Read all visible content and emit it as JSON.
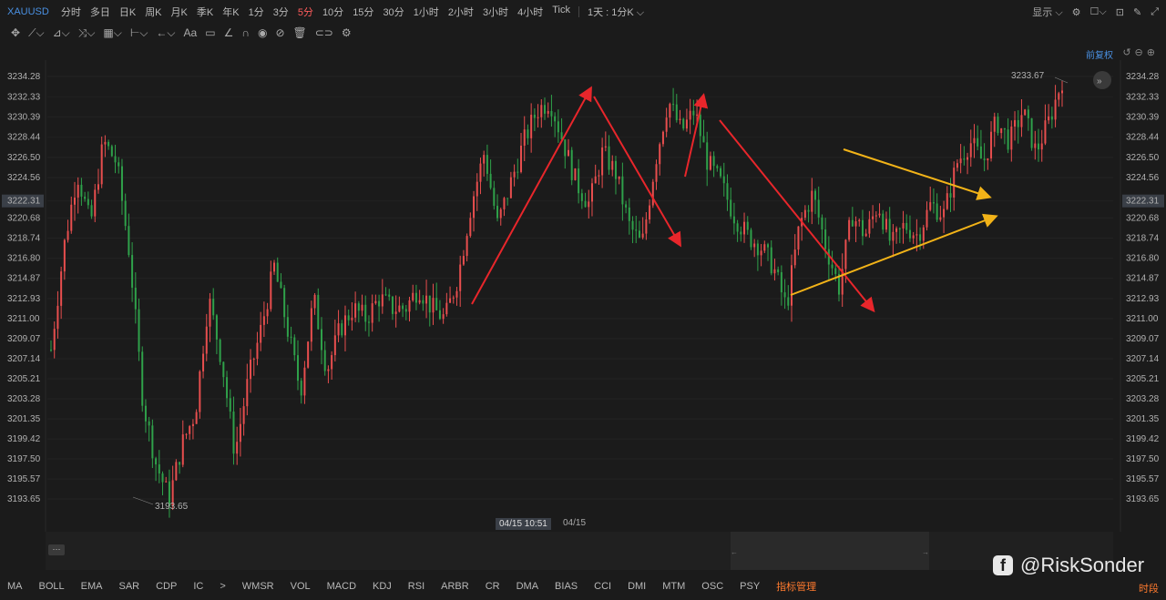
{
  "symbol": "XAUUSD",
  "timeframes": [
    "分时",
    "多日",
    "日K",
    "周K",
    "月K",
    "季K",
    "年K",
    "1分",
    "3分",
    "5分",
    "10分",
    "15分",
    "30分",
    "1小时",
    "2小时",
    "3小时",
    "4小时",
    "Tick"
  ],
  "active_timeframe": "5分",
  "period_select": "1天 : 1分K ⌵",
  "top_right": {
    "display_label": "显示 ⌵"
  },
  "price_adjust": "前复权",
  "y_ticks": [
    "3234.28",
    "3232.33",
    "3230.39",
    "3228.44",
    "3226.50",
    "3224.56",
    "3222.31",
    "3220.68",
    "3218.74",
    "3216.80",
    "3214.87",
    "3212.93",
    "3211.00",
    "3209.07",
    "3207.14",
    "3205.21",
    "3203.28",
    "3201.35",
    "3199.42",
    "3197.50",
    "3195.57",
    "3193.65"
  ],
  "current_price": "3222.31",
  "high_label": "3233.67",
  "low_label": "3193.65",
  "x_time_label": "04/15 10:51",
  "x_date_label": "04/15",
  "indicators": [
    "MA",
    "BOLL",
    "EMA",
    "SAR",
    "CDP",
    "IC",
    ">",
    "WMSR",
    "VOL",
    "MACD",
    "KDJ",
    "RSI",
    "ARBR",
    "CR",
    "DMA",
    "BIAS",
    "CCI",
    "DMI",
    "MTM",
    "OSC",
    "PSY"
  ],
  "indicator_manage": "指标管理",
  "time_label": "时段",
  "watermark": "@RiskSonder",
  "colors": {
    "up": "#e84e4e",
    "down": "#2fa14a",
    "bg": "#1b1b1b",
    "arrow_red": "#e8262b",
    "arrow_yellow": "#f2b318",
    "accent": "#4a90e2"
  },
  "chart_data": {
    "type": "candlestick",
    "ylim": [
      3193.65,
      3234.28
    ],
    "price_path": [
      3208,
      3218,
      3225,
      3220,
      3228,
      3226,
      3217,
      3203,
      3197,
      3193.65,
      3199,
      3202,
      3213,
      3207,
      3198,
      3205,
      3210,
      3216,
      3210,
      3204,
      3213,
      3206,
      3210,
      3212,
      3211,
      3213,
      3212,
      3212,
      3214,
      3212,
      3211,
      3215,
      3222,
      3227,
      3220,
      3224,
      3228,
      3231,
      3232,
      3228,
      3224,
      3222,
      3227,
      3225,
      3220,
      3218,
      3226,
      3232,
      3229,
      3231,
      3226,
      3224,
      3221,
      3219,
      3218,
      3216,
      3212,
      3220,
      3223,
      3218,
      3214,
      3221,
      3219,
      3222,
      3218,
      3220,
      3219,
      3222,
      3221,
      3226,
      3228,
      3226,
      3230,
      3228,
      3231,
      3227,
      3230,
      3234
    ]
  }
}
